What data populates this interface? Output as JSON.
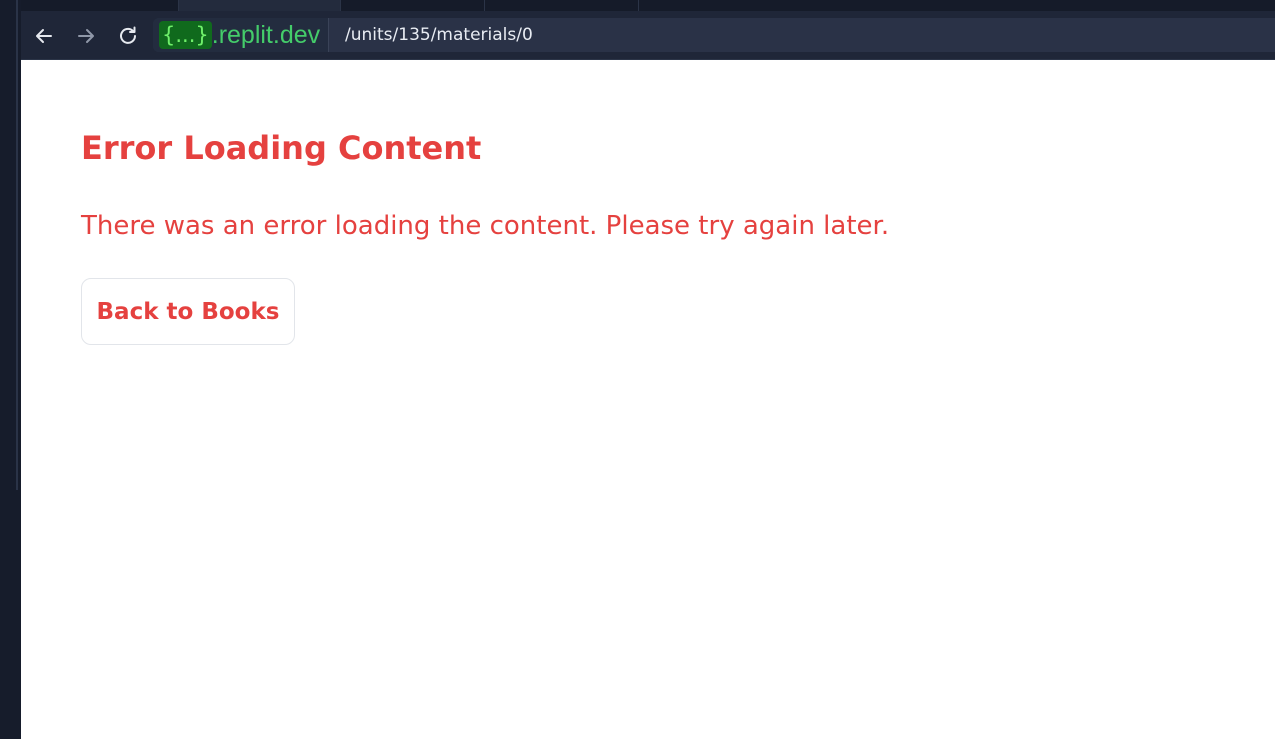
{
  "browser": {
    "address_bar": {
      "domain_badge": "{...}",
      "domain": ".replit.dev",
      "path": "/units/135/materials/0"
    },
    "icons": {
      "back": "arrow-left-icon",
      "forward": "arrow-right-icon",
      "reload": "reload-icon"
    }
  },
  "page": {
    "title": "Error Loading Content",
    "message": "There was an error loading the content. Please try again later.",
    "back_button_label": "Back to Books"
  },
  "colors": {
    "error_text": "#e5413f",
    "browser_chrome": "#1f2638",
    "domain_green": "#44cc6a",
    "page_background": "#ffffff"
  }
}
